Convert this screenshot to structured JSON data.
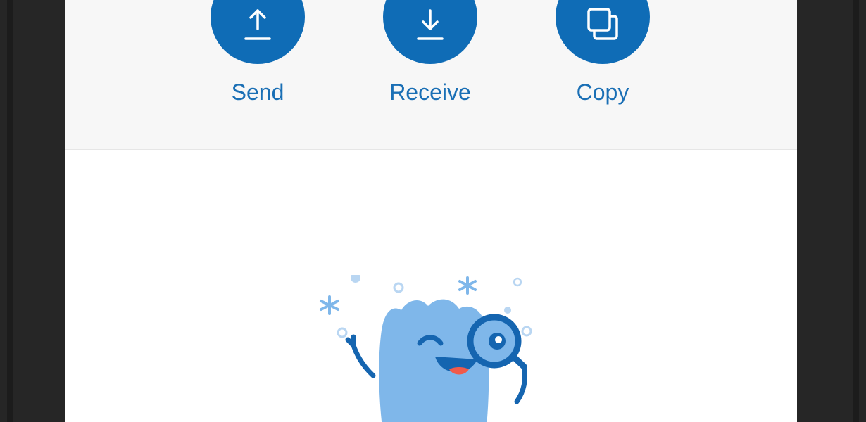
{
  "actions": {
    "send": {
      "label": "Send",
      "icon": "upload-arrow-icon"
    },
    "receive": {
      "label": "Receive",
      "icon": "download-arrow-icon"
    },
    "copy": {
      "label": "Copy",
      "icon": "copy-icon"
    }
  },
  "colors": {
    "accent": "#0f6cb6",
    "label": "#1a6fb5",
    "mascot_body": "#7fb7ea",
    "mascot_line": "#1565b0",
    "tongue": "#f15a4a",
    "panel_bg": "#f7f7f7"
  },
  "empty_state": {
    "illustration": "mascot-with-magnifying-glass"
  }
}
